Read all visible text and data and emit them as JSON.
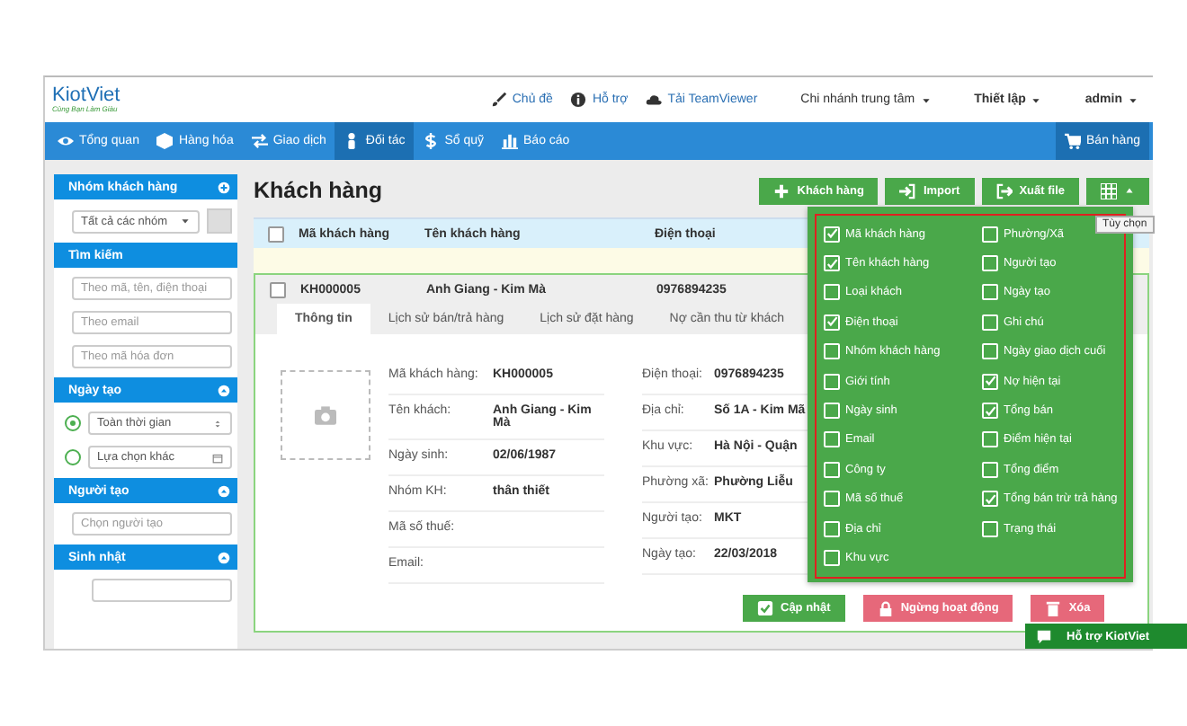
{
  "header": {
    "logo": {
      "name": "KiotViet",
      "tagline": "Cùng Bạn Làm Giàu"
    },
    "links": [
      {
        "label": "Chủ đề",
        "kind": "theme"
      },
      {
        "label": "Hỗ trợ",
        "kind": "help"
      },
      {
        "label": "Tải TeamViewer",
        "kind": "download"
      }
    ],
    "menus": [
      "Chi nhánh trung tâm",
      "Thiết lập",
      "admin"
    ]
  },
  "nav": {
    "items": [
      {
        "label": "Tổng quan",
        "kind": "eye",
        "selected": false
      },
      {
        "label": "Hàng hóa",
        "kind": "cube",
        "selected": false
      },
      {
        "label": "Giao dịch",
        "kind": "swap",
        "selected": false
      },
      {
        "label": "Đối tác",
        "kind": "person",
        "selected": true
      },
      {
        "label": "Sổ quỹ",
        "kind": "money",
        "selected": false
      },
      {
        "label": "Báo cáo",
        "kind": "chart",
        "selected": false
      }
    ],
    "sell_button": "Bán hàng"
  },
  "sidebar": {
    "sections": [
      {
        "title": "Nhóm khách hàng",
        "addable": true,
        "collapsible": false,
        "kind": "select",
        "value": "Tất cả các nhóm"
      },
      {
        "title": "Tìm kiếm",
        "addable": false,
        "collapsible": false,
        "kind": "inputs",
        "placeholders": [
          "Theo mã, tên, điện thoại",
          "Theo email",
          "Theo mã hóa đơn"
        ]
      },
      {
        "title": "Ngày tạo",
        "addable": false,
        "collapsible": true,
        "kind": "radios",
        "options": [
          {
            "label": "Toàn thời gian",
            "selected": true
          },
          {
            "label": "Lựa chọn khác",
            "selected": false
          }
        ]
      },
      {
        "title": "Người tạo",
        "addable": false,
        "collapsible": true,
        "kind": "inputs",
        "placeholders": [
          "Chọn người tạo"
        ]
      },
      {
        "title": "Sinh nhật",
        "addable": false,
        "collapsible": true,
        "kind": "stub"
      }
    ]
  },
  "page_title": "Khách hàng",
  "toolbar": [
    {
      "label": "Khách hàng",
      "kind": "add"
    },
    {
      "label": "Import",
      "kind": "import"
    },
    {
      "label": "Xuất file",
      "kind": "export"
    }
  ],
  "column_picker": {
    "expanded": true,
    "tooltip": "Tùy chọn"
  },
  "table": {
    "header_checked": false,
    "columns": [
      "Mã khách hàng",
      "Tên khách hàng",
      "Điện thoại"
    ],
    "rows": [
      {
        "checked": false,
        "expanded": true,
        "cells": [
          "KH000005",
          "Anh Giang - Kim Mà",
          "0976894235"
        ]
      }
    ]
  },
  "detail": {
    "tabs": [
      {
        "label": "Thông tin",
        "selected": true
      },
      {
        "label": "Lịch sử bán/trả hàng",
        "selected": false
      },
      {
        "label": "Lịch sử đặt hàng",
        "selected": false
      },
      {
        "label": "Nợ cần thu từ khách",
        "selected": false
      }
    ],
    "left_fields": [
      {
        "label": "Mã khách hàng:",
        "value": "KH000005"
      },
      {
        "label": "Tên khách:",
        "value": "Anh Giang - Kim Mà"
      },
      {
        "label": "Ngày sinh:",
        "value": "02/06/1987"
      },
      {
        "label": "Nhóm KH:",
        "value": "thân thiết"
      },
      {
        "label": "Mã số thuế:"
      },
      {
        "label": "Email:"
      }
    ],
    "right_fields": [
      {
        "label": "Điện thoại:",
        "value": "0976894235"
      },
      {
        "label": "Địa chỉ:",
        "value": "Số 1A - Kim Mã"
      },
      {
        "label": "Khu vực:",
        "value": "Hà Nội - Quận"
      },
      {
        "label": "Phường xã:",
        "value": "Phường Liễu"
      },
      {
        "label": "Người tạo:",
        "value": "MKT"
      },
      {
        "label": "Ngày tạo:",
        "value": "22/03/2018"
      }
    ],
    "actions": [
      {
        "label": "Cập nhật",
        "kind": "update"
      },
      {
        "label": "Ngừng hoạt động",
        "kind": "deactivate"
      },
      {
        "label": "Xóa",
        "kind": "delete"
      }
    ]
  },
  "column_menu": {
    "columns": [
      [
        {
          "label": "Mã khách hàng",
          "checked": true
        },
        {
          "label": "Tên khách hàng",
          "checked": true
        },
        {
          "label": "Loại khách",
          "checked": false
        },
        {
          "label": "Điện thoại",
          "checked": true
        },
        {
          "label": "Nhóm khách hàng",
          "checked": false
        },
        {
          "label": "Giới tính",
          "checked": false
        },
        {
          "label": "Ngày sinh",
          "checked": false
        },
        {
          "label": "Email",
          "checked": false
        },
        {
          "label": "Công ty",
          "checked": false
        },
        {
          "label": "Mã số thuế",
          "checked": false
        },
        {
          "label": "Địa chỉ",
          "checked": false
        },
        {
          "label": "Khu vực",
          "checked": false
        }
      ],
      [
        {
          "label": "Phường/Xã",
          "checked": false
        },
        {
          "label": "Người tạo",
          "checked": false
        },
        {
          "label": "Ngày tạo",
          "checked": false
        },
        {
          "label": "Ghi chú",
          "checked": false
        },
        {
          "label": "Ngày giao dịch cuối",
          "checked": false
        },
        {
          "label": "Nợ hiện tại",
          "checked": true
        },
        {
          "label": "Tổng bán",
          "checked": true
        },
        {
          "label": "Điểm hiện tại",
          "checked": false
        },
        {
          "label": "Tổng điểm",
          "checked": false
        },
        {
          "label": "Tổng bán trừ trả hàng",
          "checked": true
        },
        {
          "label": "Trạng thái",
          "checked": false
        }
      ]
    ]
  },
  "support_chat": {
    "label": "Hỗ trợ KiotViet"
  }
}
